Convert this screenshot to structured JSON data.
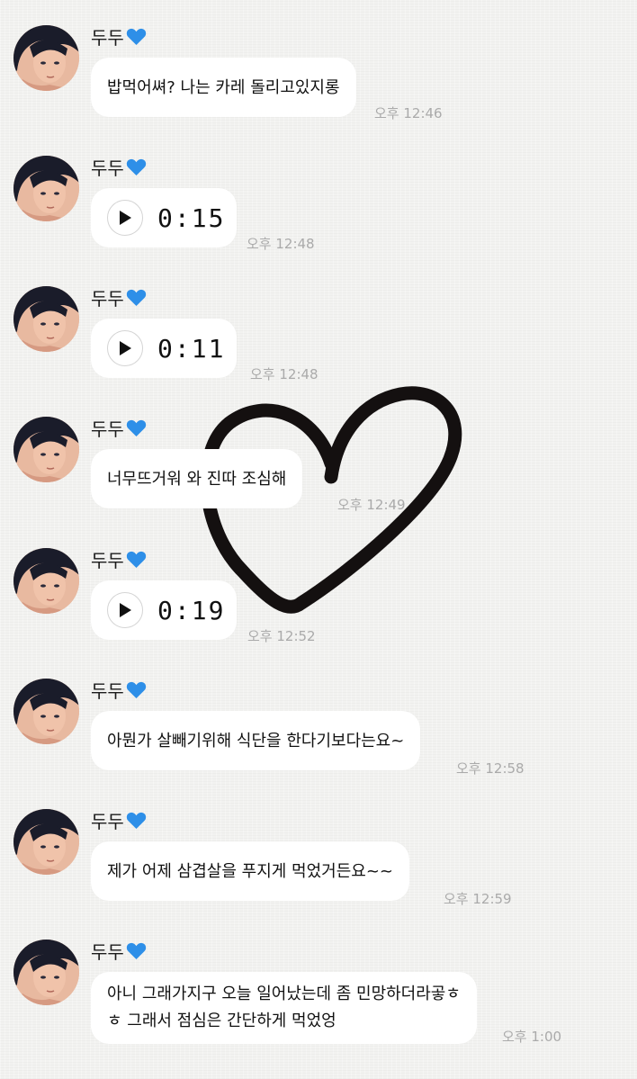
{
  "sender_name": "두두",
  "messages": [
    {
      "type": "text",
      "text": "밥먹어쎠? 나는 카레 돌리고있지롱",
      "time": "오후 12:46"
    },
    {
      "type": "voice",
      "duration": "0:15",
      "time": "오후 12:48"
    },
    {
      "type": "voice",
      "duration": "0:11",
      "time": "오후 12:48"
    },
    {
      "type": "text",
      "text": "너무뜨거워 와 진따 조심해",
      "time": "오후 12:49"
    },
    {
      "type": "voice",
      "duration": "0:19",
      "time": "오후 12:52"
    },
    {
      "type": "text",
      "text": "아뭔가 살빼기위해 식단을 한다기보다는요~",
      "time": "오후 12:58"
    },
    {
      "type": "text",
      "text": "제가 어제 삼겹살을 푸지게 먹었거든요~~",
      "time": "오후 12:59"
    },
    {
      "type": "text",
      "lines": [
        "아니 그래가지구 오늘 일어났는데 좀 민망하더라곻ㅎ",
        "ㅎ 그래서 점심은 간단하게 먹었엉"
      ],
      "time": "오후 1:00"
    }
  ],
  "icons": {
    "name_suffix": "blue-heart-icon",
    "play": "play-icon",
    "background_decoration": "hand-drawn-heart"
  },
  "colors": {
    "blue_heart": "#2e8fe8",
    "bubble": "#ffffff",
    "timestamp": "#aaaaaa",
    "drawn_heart": "#141010"
  }
}
